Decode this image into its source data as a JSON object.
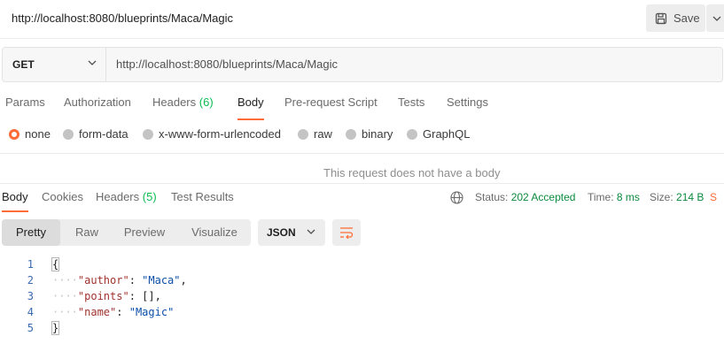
{
  "request": {
    "title": "http://localhost:8080/blueprints/Maca/Magic",
    "save_label": "Save",
    "method": "GET",
    "url": "http://localhost:8080/blueprints/Maca/Magic"
  },
  "request_tabs": [
    {
      "label": "Params"
    },
    {
      "label": "Authorization"
    },
    {
      "label": "Headers",
      "count": "(6)"
    },
    {
      "label": "Body",
      "active": true
    },
    {
      "label": "Pre-request Script"
    },
    {
      "label": "Tests"
    },
    {
      "label": "Settings"
    }
  ],
  "body_types": [
    {
      "label": "none",
      "selected": true
    },
    {
      "label": "form-data"
    },
    {
      "label": "x-www-form-urlencoded"
    },
    {
      "label": "raw"
    },
    {
      "label": "binary"
    },
    {
      "label": "GraphQL"
    }
  ],
  "no_body_message": "This request does not have a body",
  "response_tabs": [
    {
      "label": "Body",
      "active": true
    },
    {
      "label": "Cookies"
    },
    {
      "label": "Headers",
      "count": "(5)"
    },
    {
      "label": "Test Results"
    }
  ],
  "response_status": {
    "status_label": "Status:",
    "status_value": "202 Accepted",
    "time_label": "Time:",
    "time_value": "8 ms",
    "size_label": "Size:",
    "size_value": "214 B",
    "overflow": "S"
  },
  "view_modes": [
    "Pretty",
    "Raw",
    "Preview",
    "Visualize"
  ],
  "format": "JSON",
  "code_lines": [
    {
      "n": "1"
    },
    {
      "n": "2",
      "key": "\"author\"",
      "value": "\"Maca\"",
      "trail": ","
    },
    {
      "n": "3",
      "key": "\"points\"",
      "value": "[]",
      "trail": ","
    },
    {
      "n": "4",
      "key": "\"name\"",
      "value": "\"Magic\"",
      "trail": ""
    },
    {
      "n": "5"
    }
  ],
  "colors": {
    "accent": "#ff6c37",
    "success": "#0cbb52",
    "json_key": "#a0332f",
    "json_string": "#0b4fa8"
  }
}
